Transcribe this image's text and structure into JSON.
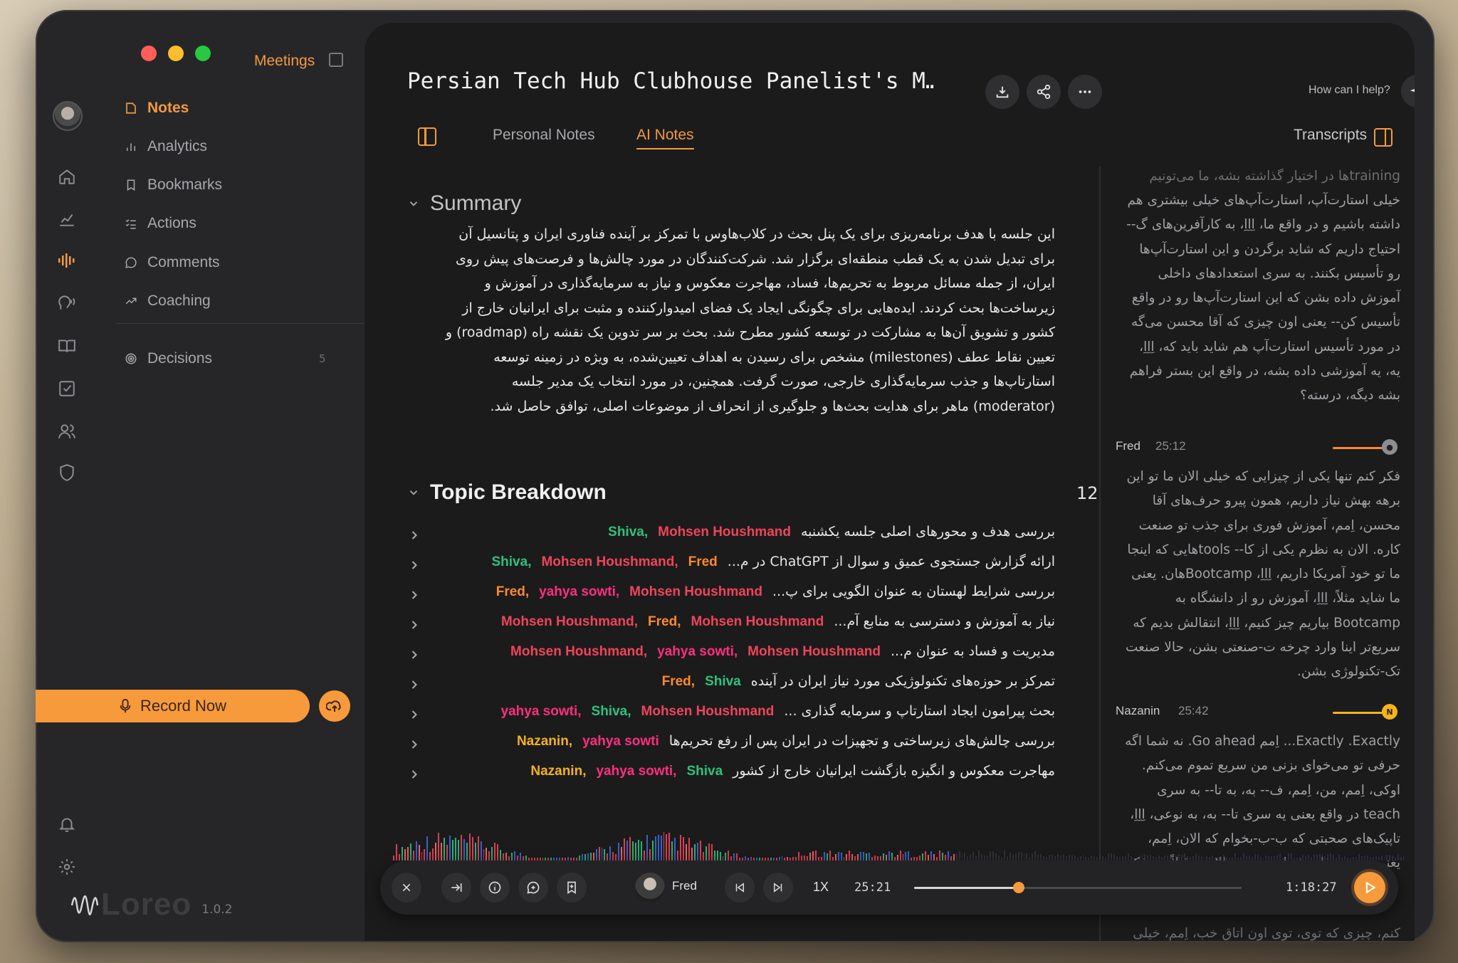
{
  "nav": {
    "title": "Meetings",
    "items": [
      {
        "label": "Notes",
        "icon": "note-icon",
        "active": true
      },
      {
        "label": "Analytics",
        "icon": "bar-chart-icon"
      },
      {
        "label": "Bookmarks",
        "icon": "bookmark-icon"
      },
      {
        "label": "Actions",
        "icon": "checklist-icon"
      },
      {
        "label": "Comments",
        "icon": "comment-icon"
      },
      {
        "label": "Coaching",
        "icon": "trend-icon"
      },
      {
        "label": "Decisions",
        "icon": "target-icon"
      }
    ],
    "decisions_count": "5",
    "record_label": "Record Now"
  },
  "brand": {
    "name": "Loreo",
    "version": "1.0.2"
  },
  "header": {
    "title": "Persian Tech Hub Clubhouse Panelist's M…",
    "help": "How can I help?"
  },
  "tabs": {
    "personal": "Personal Notes",
    "ai": "AI Notes",
    "transcripts": "Transcripts"
  },
  "summary": {
    "title": "Summary",
    "text": "این جلسه با هدف برنامه‌ریزی برای یک پنل بحث در کلاب‌هاوس با تمرکز بر آینده فناوری ایران و پتانسیل آن برای تبدیل شدن به یک قطب منطقه‌ای برگزار شد. شرکت‌کنندگان در مورد چالش‌ها و فرصت‌های پیش روی ایران، از جمله مسائل مربوط به تحریم‌ها، فساد، مهاجرت معکوس و نیاز به سرمایه‌گذاری در آموزش و زیرساخت‌ها بحث کردند. ایده‌هایی برای چگونگی ایجاد یک فضای امیدوارکننده و مثبت برای ایرانیان خارج از کشور و تشویق آن‌ها به مشارکت در توسعه کشور مطرح شد. بحث بر سر تدوین یک نقشه راه (roadmap) و تعیین نقاط عطف (milestones) مشخص برای رسیدن به اهداف تعیین‌شده، به ویژه در زمینه توسعه استارتاپ‌ها و جذب سرمایه‌گذاری خارجی، صورت گرفت. همچنین، در مورد انتخاب یک مدیر جلسه (moderator) ماهر برای هدایت بحث‌ها و جلوگیری از انحراف از موضوعات اصلی، توافق حاصل شد."
  },
  "topics": {
    "title": "Topic Breakdown",
    "count": "12",
    "items": [
      {
        "text": "بررسی هدف و محورهای اصلی جلسه یکشنبه",
        "speakers": [
          {
            "name": "Shiva,",
            "color": "#2ec27e"
          },
          {
            "name": "Mohsen Houshmand",
            "color": "#f0445a"
          }
        ]
      },
      {
        "text": "ارائه گزارش جستجوی عمیق و سوال از ChatGPT در م...",
        "speakers": [
          {
            "name": "Shiva,",
            "color": "#2ec27e"
          },
          {
            "name": "Mohsen Houshmand,",
            "color": "#f0445a"
          },
          {
            "name": "Fred",
            "color": "#ff8a2a"
          }
        ]
      },
      {
        "text": "بررسی شرایط لهستان به عنوان الگویی برای پ...",
        "speakers": [
          {
            "name": "Fred,",
            "color": "#ff8a2a"
          },
          {
            "name": "yahya sowti,",
            "color": "#ff2e7e"
          },
          {
            "name": "Mohsen Houshmand",
            "color": "#f0445a"
          }
        ]
      },
      {
        "text": "نیاز به آموزش و دسترسی به منابع آم...",
        "speakers": [
          {
            "name": "Mohsen Houshmand,",
            "color": "#f0445a"
          },
          {
            "name": "Fred,",
            "color": "#ff8a2a"
          },
          {
            "name": "Mohsen Houshmand",
            "color": "#f0445a"
          }
        ]
      },
      {
        "text": "مدیریت و فساد به عنوان م...",
        "speakers": [
          {
            "name": "Mohsen Houshmand,",
            "color": "#f0445a"
          },
          {
            "name": "yahya sowti,",
            "color": "#ff2e7e"
          },
          {
            "name": "Mohsen Houshmand",
            "color": "#f0445a"
          }
        ]
      },
      {
        "text": "تمرکز بر حوزه‌های تکنولوژیکی مورد نیاز ایران در آینده",
        "speakers": [
          {
            "name": "Fred,",
            "color": "#ff8a2a"
          },
          {
            "name": "Shiva",
            "color": "#2ec27e"
          }
        ]
      },
      {
        "text": "بحث پیرامون ایجاد استارتاپ و سرمایه گذاری ...",
        "speakers": [
          {
            "name": "yahya sowti,",
            "color": "#ff2e7e"
          },
          {
            "name": "Shiva,",
            "color": "#2ec27e"
          },
          {
            "name": "Mohsen Houshmand",
            "color": "#f0445a"
          }
        ]
      },
      {
        "text": "بررسی چالش‌های زیرساختی و تجهیزات در ایران پس از رفع تحریم‌ها",
        "speakers": [
          {
            "name": "Nazanin,",
            "color": "#f5b31b"
          },
          {
            "name": "yahya sowti",
            "color": "#ff2e7e"
          }
        ]
      },
      {
        "text": "مهاجرت معکوس و انگیزه بازگشت ایرانیان خارج از کشور",
        "speakers": [
          {
            "name": "Nazanin,",
            "color": "#f5b31b"
          },
          {
            "name": "yahya sowti,",
            "color": "#ff2e7e"
          },
          {
            "name": "Shiva",
            "color": "#2ec27e"
          }
        ]
      }
    ]
  },
  "transcript": {
    "top_fade": "trainingها در اختیار گذاشته بشه، ما می‌تونیم",
    "block0": "خیلی استارت‌آپ، استارت‌آپ‌های خیلی بیشتری هم داشته باشیم و در واقع ما، اِاِاِ، به کارآفرین‌های گ-- احتیاج داریم که شاید برگردن و این استارت‌آپ‌ها رو تأسیس بکنند. به سری استعدادهای داخلی آموزش داده بشن که این استارت‌آپ‌ها رو در واقع تأسیس کن-- یعنی اون چیزی که آقا محسن می‌گه در مورد تأسیس استارت‌آپ هم شاید باید که، اِاِاِ، یه، یه آموزشی داده بشه، در واقع این بستر فراهم بشه دیگه، درسته؟",
    "entries": [
      {
        "speaker": "Fred",
        "time": "25:12",
        "color": "#ff8a2a",
        "initial": "",
        "text": "فکر کنم تنها یکی از چیزایی که خیلی الان ما تو این برهه بهش نیاز داریم، همون پیرو حرف‌های آقا محسن، اِمم، آموزش فوری برای جذب تو صنعت کاره. الان به نظرم یکی از کا-- toolsهایی که اینجا ما تو خود آمریکا داریم، اِاِاِ، Bootcampهان. یعنی ما شاید مثلاً، اِاِاِ، آموزش رو از دانشگاه به Bootcamp بیاریم چیز کنیم، اِاِاِ، انتقالش بدیم که سریع‌تر اینا وارد چرخه ت-صنعتی بشن، حالا صنعت تک-تکنولوژی بشن."
      },
      {
        "speaker": "Nazanin",
        "time": "25:42",
        "color": "#f5b31b",
        "initial": "N",
        "text": "Exactly .Exactly... اِمم Go ahead. نه شما اگه حرفی تو می‌خوای بزنی من سریع تموم می‌کنم. اوکی، اِمم، من، اِمم، ف-- به، به تا-- به سری teach در واقع یعنی یه سری تا-- به، به نوعی، اِاِاِ، تاپیک‌های صحبتی که ب-ب-بخوام که الان، اِمم، یعنی توی حرفای شما هم بود، حالا من قبلاً هم فکر"
      }
    ],
    "bottom_fade": "کنم، چیزی که توی، توی اون اتاق خب، اِمم، خیلی"
  },
  "player": {
    "speaker": "Fred",
    "speed": "1X",
    "current": "25:21",
    "total": "1:18:27",
    "progress": 0.32
  },
  "colors": {
    "accent": "#f79a3b",
    "panel": "#1b1b1c",
    "window": "#262628"
  }
}
